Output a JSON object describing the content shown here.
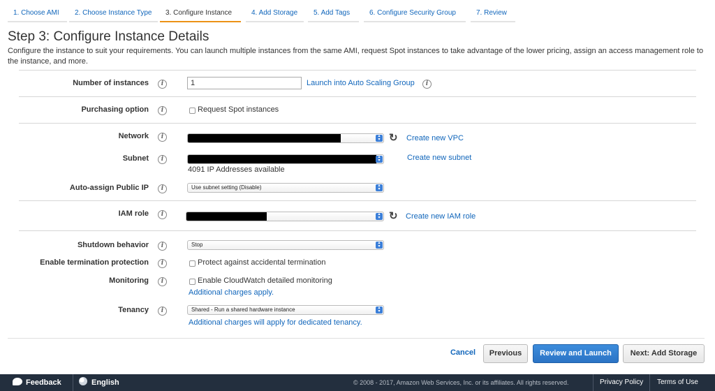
{
  "tabs": [
    {
      "label": "1. Choose AMI",
      "active": false
    },
    {
      "label": "2. Choose Instance Type",
      "active": false
    },
    {
      "label": "3. Configure Instance",
      "active": true
    },
    {
      "label": "4. Add Storage",
      "active": false
    },
    {
      "label": "5. Add Tags",
      "active": false
    },
    {
      "label": "6. Configure Security Group",
      "active": false
    },
    {
      "label": "7. Review",
      "active": false
    }
  ],
  "page": {
    "title": "Step 3: Configure Instance Details",
    "description": "Configure the instance to suit your requirements. You can launch multiple instances from the same AMI, request Spot instances to take advantage of the lower pricing, assign an access management role to the instance, and more."
  },
  "form": {
    "num_instances": {
      "label": "Number of instances",
      "value": "1",
      "link": "Launch into Auto Scaling Group"
    },
    "purchasing": {
      "label": "Purchasing option",
      "checkbox_label": "Request Spot instances"
    },
    "network": {
      "label": "Network",
      "link": "Create new VPC"
    },
    "subnet": {
      "label": "Subnet",
      "link": "Create new subnet",
      "note": "4091 IP Addresses available"
    },
    "public_ip": {
      "label": "Auto-assign Public IP",
      "value": "Use subnet setting (Disable)"
    },
    "iam_role": {
      "label": "IAM role",
      "link": "Create new IAM role"
    },
    "shutdown": {
      "label": "Shutdown behavior",
      "value": "Stop"
    },
    "termination": {
      "label": "Enable termination protection",
      "checkbox_label": "Protect against accidental termination"
    },
    "monitoring": {
      "label": "Monitoring",
      "checkbox_label": "Enable CloudWatch detailed monitoring",
      "link": "Additional charges apply."
    },
    "tenancy": {
      "label": "Tenancy",
      "value": "Shared - Run a shared hardware instance",
      "link": "Additional charges will apply for dedicated tenancy."
    }
  },
  "buttons": {
    "cancel": "Cancel",
    "previous": "Previous",
    "review_launch": "Review and Launch",
    "next": "Next: Add Storage"
  },
  "footer": {
    "feedback": "Feedback",
    "language": "English",
    "copyright": "© 2008 - 2017, Amazon Web Services, Inc. or its affiliates. All rights reserved.",
    "privacy": "Privacy Policy",
    "terms": "Terms of Use"
  },
  "icons": {
    "info": "info-icon",
    "refresh": "refresh-icon",
    "dropdown": "dropdown-arrow-icon",
    "feedback": "speech-bubble-icon",
    "language": "globe-icon"
  },
  "colors": {
    "link": "#1166bb",
    "active_tab": "#ec9216",
    "primary_button": "#2b74c5",
    "footer_bg": "#232f3e"
  }
}
